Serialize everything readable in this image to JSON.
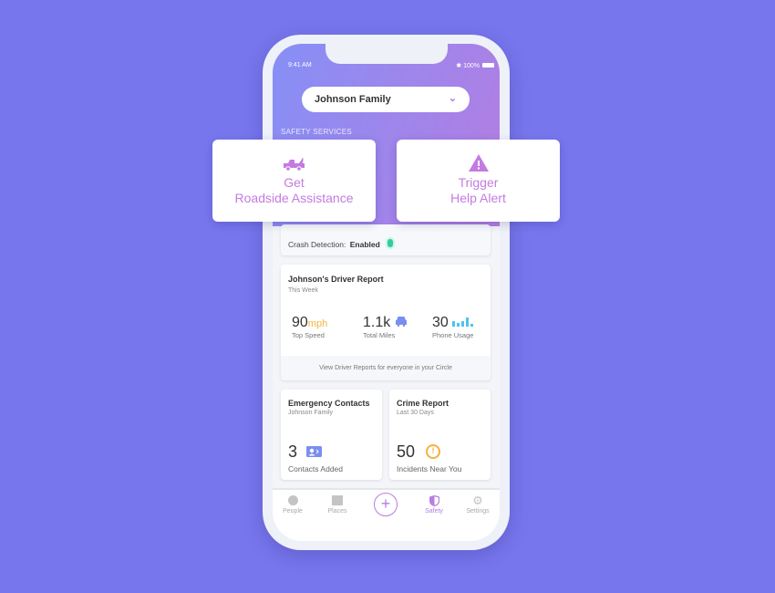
{
  "status": {
    "time": "9:41 AM",
    "battery": "100%"
  },
  "circle_selector": {
    "value": "Johnson Family"
  },
  "section_title": "SAFETY SERVICES",
  "actions": [
    {
      "line1": "Get",
      "line2": "Roadside Assistance",
      "icon": "tow-truck-icon"
    },
    {
      "line1": "Trigger",
      "line2": "Help Alert",
      "icon": "warning-icon"
    }
  ],
  "crash": {
    "label": "Crash Detection:",
    "value": "Enabled",
    "status_color": "#2ecf9a"
  },
  "driver_report": {
    "title": "Johnson's Driver Report",
    "subtitle": "This Week",
    "stats": [
      {
        "value": "90",
        "unit": "mph",
        "label": "Top Speed"
      },
      {
        "value": "1.1k",
        "label": "Total Miles",
        "icon": "car-icon"
      },
      {
        "value": "30",
        "label": "Phone Usage",
        "icon": "signal-bars-icon"
      }
    ],
    "footer": "View Driver Reports for everyone in your Circle"
  },
  "emergency": {
    "title": "Emergency Contacts",
    "subtitle": "Johnson Family",
    "value": "3",
    "label": "Contacts Added"
  },
  "crime": {
    "title": "Crime Report",
    "subtitle": "Last 30 Days",
    "value": "50",
    "label": "Incidents Near You"
  },
  "tabs": [
    {
      "label": "People"
    },
    {
      "label": "Places"
    },
    {
      "label": "Safety",
      "active": true
    },
    {
      "label": "Settings"
    }
  ],
  "colors": {
    "accent": "#b67ee0",
    "background": "#7776ec",
    "speed_unit": "#f5b13d",
    "blue_icon": "#7b8ef0"
  }
}
